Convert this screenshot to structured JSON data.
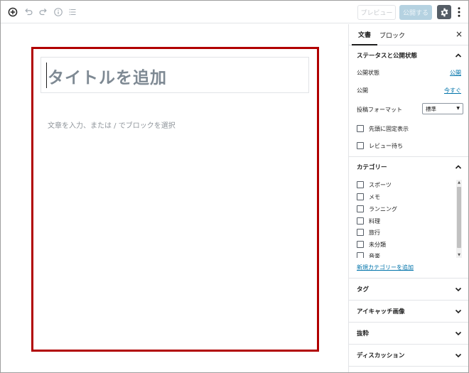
{
  "toolbar": {
    "preview_label": "プレビュー",
    "publish_label": "公開する",
    "icons": [
      "plus-circle-icon",
      "undo-icon",
      "redo-icon",
      "info-icon",
      "list-view-icon",
      "gear-icon",
      "more-vertical-icon"
    ]
  },
  "editor": {
    "title_placeholder": "タイトルを追加",
    "body_placeholder": "文章を入力、または / でブロックを選択"
  },
  "sidebar": {
    "tabs": [
      {
        "label": "文書",
        "active": true
      },
      {
        "label": "ブロック",
        "active": false
      }
    ],
    "close_label": "×",
    "status_panel": {
      "title": "ステータスと公開状態",
      "visibility_label": "公開状態",
      "visibility_value": "公開",
      "publish_label": "公開",
      "publish_value": "今すぐ",
      "format_label": "投稿フォーマット",
      "format_value": "標準",
      "sticky_label": "先頭に固定表示",
      "pending_label": "レビュー待ち"
    },
    "category_panel": {
      "title": "カテゴリー",
      "items": [
        "スポーツ",
        "メモ",
        "ランニング",
        "料理",
        "旅行",
        "未分類",
        "音楽"
      ],
      "add_label": "新規カテゴリーを追加"
    },
    "collapsed_panels": [
      "タグ",
      "アイキャッチ画像",
      "抜粋",
      "ディスカッション"
    ]
  },
  "colors": {
    "highlight": "#b10000",
    "link": "#0073aa",
    "publish_disabled": "#b5d2e1"
  }
}
